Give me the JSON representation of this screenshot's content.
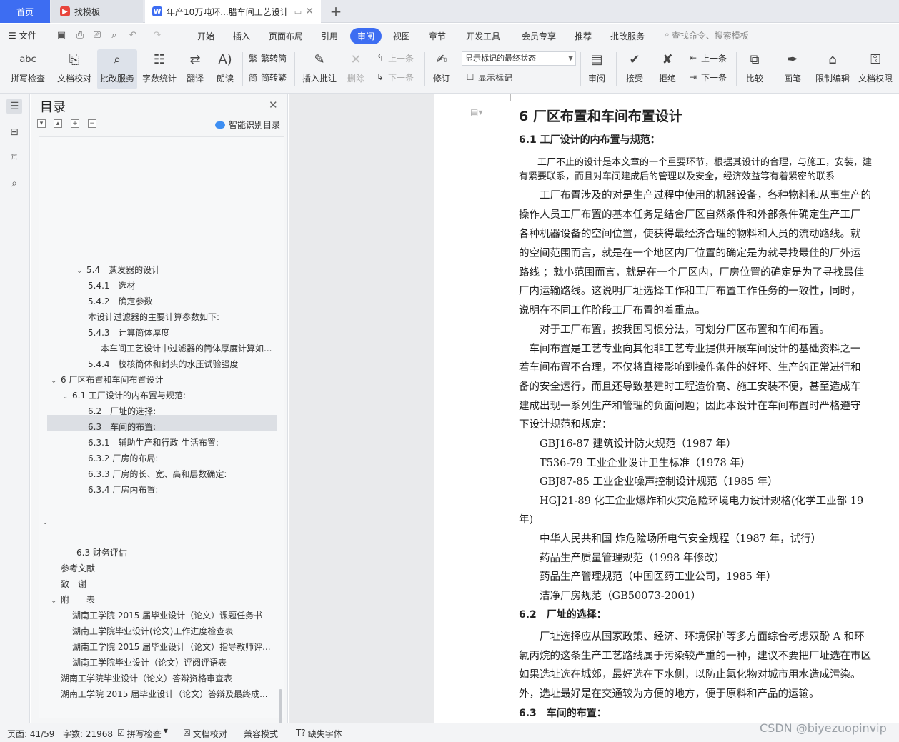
{
  "tabs": {
    "home": "首页",
    "templates": "找模板",
    "doc": "年产10万吨环...腊车间工艺设计"
  },
  "menu": {
    "file": "文件",
    "items": [
      "开始",
      "插入",
      "页面布局",
      "引用",
      "审阅",
      "视图",
      "章节",
      "开发工具",
      "会员专享",
      "推荐",
      "批改服务"
    ],
    "active": "审阅",
    "search": "查找命令、搜索模板"
  },
  "ribbon": {
    "spell": "拼写检查",
    "proof": "文档校对",
    "correct": "批改服务",
    "count": "字数统计",
    "translate": "翻译",
    "read": "朗读",
    "trad": "繁转简",
    "simp": "简转繁",
    "insert_comment": "插入批注",
    "delete": "删除",
    "prev_comment": "上一条",
    "next_comment": "下一条",
    "revise": "修订",
    "markup_mode": "显示标记的最终状态",
    "show_markup": "显示标记",
    "review": "审阅",
    "accept": "接受",
    "reject": "拒绝",
    "prev": "上一条",
    "next": "下一条",
    "compare": "比较",
    "pen": "画笔",
    "restrict": "限制编辑",
    "perm": "文档权限"
  },
  "toc": {
    "title": "目录",
    "smart": "智能识别目录",
    "items": [
      "5.4　蒸发器的设计",
      "5.4.1　选材",
      "5.4.2　确定参数",
      "本设计过滤器的主要计算参数如下:",
      "5.4.3　计算筒体厚度",
      "本车间工艺设计中过滤器的筒体厚度计算如...",
      "5.4.4　校核筒体和封头的水压试验强度",
      "6 厂区布置和车间布置设计",
      "6.1 工厂设计的内布置与规范:",
      "6.2　厂址的选择:",
      "6.3　车间的布置:",
      "6.3.1　辅助生产和行政-生活布置:",
      "6.3.2 厂房的布局:",
      "6.3.3 厂房的长、宽、高和层数确定:",
      "6.3.4 厂房内布置:",
      "",
      "6.3 财务评估",
      "参考文献",
      "致　谢",
      "附　　表",
      "湖南工学院 2015 届毕业设计（论文）课题任务书",
      "湖南工学院毕业设计(论文)工作进度检查表",
      "湖南工学院 2015 届毕业设计（论文）指导教师评...",
      "湖南工学院毕业设计（论文）评阅评语表",
      "湖南工学院毕业设计（论文）答辩资格审查表",
      "湖南工学院 2015 届毕业设计（论文）答辩及最终成..."
    ]
  },
  "doc": {
    "h1": "6 厂区布置和车间布置设计",
    "h2a": "6.1 工厂设计的内布置与规范：",
    "lines": [
      "　　工厂不止的设计是本文章的一个重要环节，根据其设计的合理，与施工，安装，建",
      "有紧要联系，而且对车间建成后的管理以及安全，经济效益等有着紧密的联系",
      "　　工厂布置涉及的对是生产过程中使用的机器设备，各种物料和从事生产的",
      "操作人员工厂布置的基本任务是结合厂区自然条件和外部条件确定生产工厂",
      "各种机器设备的空间位置，使获得最经济合理的物料和人员的流动路线。就",
      "的空间范围而言，就是在一个地区内厂位置的确定是为就寻找最佳的厂外运",
      "路线 ；就小范围而言，就是在一个厂区内，厂房位置的确定是为了寻找最佳",
      "厂内运输路线。这说明厂址选择工作和工厂布置工作任务的一致性，同时，",
      "说明在不同工作阶段工厂布置的着重点。",
      "　　对于工厂布置，按我国习惯分法，可划分厂区布置和车间布置。",
      "　车间布置是工艺专业向其他非工艺专业提供开展车间设计的基础资料之一",
      "若车间布置不合理，不仅将直接影响到操作条件的好坏、生产的正常进行和",
      "备的安全运行，而且还导致基建时工程造价高、施工安装不便，甚至造成车",
      "建成出现一系列生产和管理的负面问题；因此本设计在车间布置时严格遵守",
      "下设计规范和规定：",
      "　　GBJ16-87 建筑设计防火规范（1987 年）",
      "　　T536-79 工业企业设计卫生标准（1978 年）",
      "　　GBJ87-85 工业企业噪声控制设计规范（1985 年）",
      "　　HGJ21-89 化工企业爆炸和火灾危险环境电力设计规格(化学工业部 19",
      "年)",
      "　　中华人民共和国 炸危险场所电气安全规程（1987 年，试行）",
      "　　药品生产质量管理规范（1998 年修改）",
      "　　药品生产管理规范（中国医药工业公司，1985 年）",
      "　　洁净厂房规范（GB50073-2001）"
    ],
    "h2b": "6.2　厂址的选择：",
    "lines2": [
      "　　厂址选择应从国家政策、经济、环境保护等多方面综合考虑双酚 A 和环",
      "氯丙烷的这条生产工艺路线属于污染较严重的一种，建议不要把厂址选在市区",
      "如果选址选在城郊，最好选在下水侧，以防止氯化物对城市用水造成污染。",
      "外，选址最好是在交通较为方便的地方，便于原料和产品的运输。"
    ],
    "h2c": "6.3　车间的布置："
  },
  "status": {
    "page": "页面: 41/59",
    "words": "字数: 21968",
    "spell": "拼写检查",
    "proof": "文档校对",
    "compat": "兼容模式",
    "font": "缺失字体"
  },
  "watermark": "CSDN @biyezuopinvip"
}
